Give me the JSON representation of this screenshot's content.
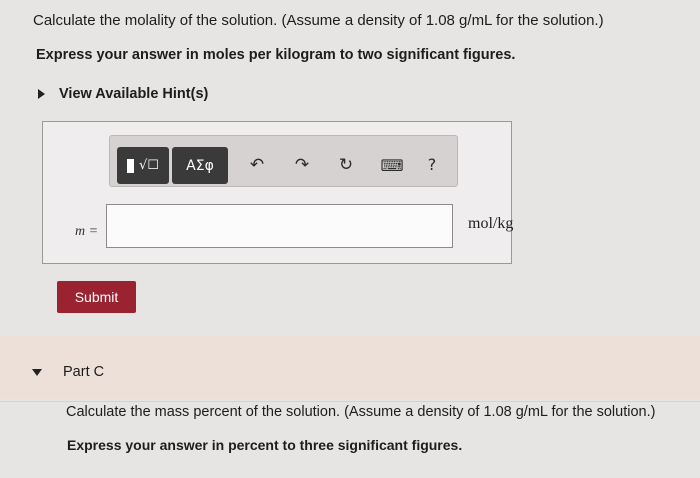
{
  "question": {
    "line1": "Calculate the molality of the solution. (Assume a density of 1.08 g/mL for the solution.)",
    "line2": "Express your answer in moles per kilogram to two significant figures."
  },
  "hints": {
    "label": "View Available Hint(s)"
  },
  "toolbar": {
    "templates_glyph": "√☐",
    "greek_label": "ΑΣφ",
    "undo_glyph": "↶",
    "redo_glyph": "↷",
    "reset_glyph": "↻",
    "keyboard_glyph": "⌨",
    "help_glyph": "?"
  },
  "answer": {
    "variable": "m =",
    "value": "",
    "unit": "mol/kg"
  },
  "submit": {
    "label": "Submit"
  },
  "part_c": {
    "title": "Part C",
    "line1": "Calculate the mass percent of the solution. (Assume a density of 1.08 g/mL for the solution.)",
    "line2": "Express your answer in percent to three significant figures."
  }
}
